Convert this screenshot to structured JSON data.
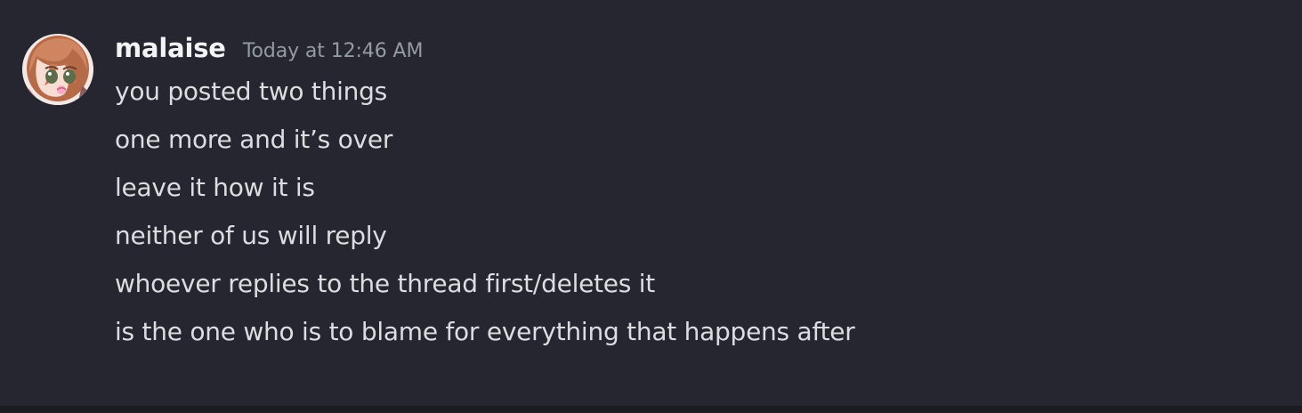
{
  "message": {
    "author": "malaise",
    "timestamp": "Today at 12:46 AM",
    "avatar_icon": "anime-avatar-icon",
    "lines": [
      "you posted two things",
      "one more and it’s over",
      "leave it how it is",
      "neither of us will reply",
      "whoever replies to the thread first/deletes it",
      "is the one who is to blame for everything that happens after"
    ]
  },
  "colors": {
    "background": "#252630",
    "username": "#f2f3f5",
    "timestamp": "#949ba4",
    "message_text": "#dbdee1"
  }
}
